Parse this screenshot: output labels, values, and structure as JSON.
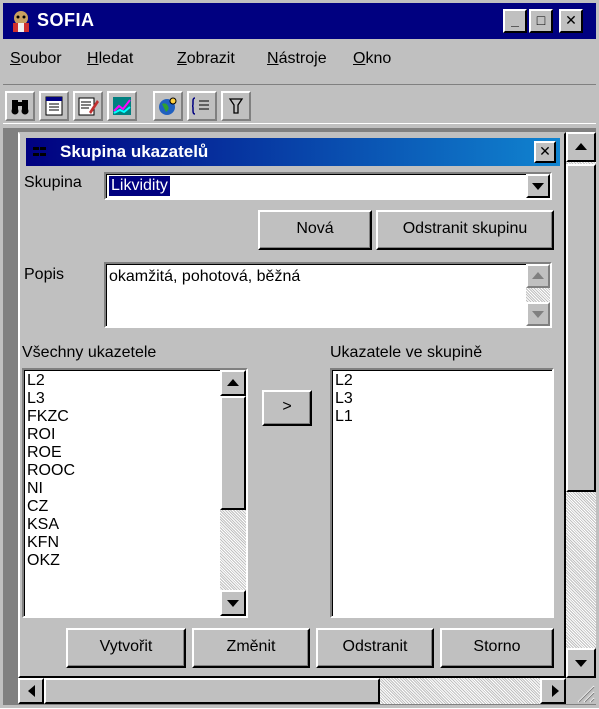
{
  "window": {
    "title": "SOFIA",
    "controls": {
      "minimize": "_",
      "maximize": "□",
      "close": "✕"
    }
  },
  "menu": [
    "Soubor",
    "Hledat",
    "Zobrazit",
    "Nástroje",
    "Okno"
  ],
  "toolbar": {
    "icons": [
      "binoculars-icon",
      "table-icon",
      "edit-icon",
      "chart-icon",
      "globe-icon",
      "list-icon",
      "help-icon"
    ]
  },
  "dialog": {
    "title": "Skupina ukazatelů",
    "close": "✕",
    "group": {
      "label": "Skupina",
      "value": "Likvidity"
    },
    "buttons": {
      "new": "Nová",
      "remove_group": "Odstranit skupinu"
    },
    "description": {
      "label": "Popis",
      "value": "okamžitá, pohotová, běžná"
    },
    "all_indicators": {
      "label": "Všechny ukazetele",
      "items": [
        "L2",
        "L3",
        "FKZC",
        "ROI",
        "ROE",
        "ROOC",
        "NI",
        "CZ",
        "KSA",
        "KFN",
        "OKZ"
      ]
    },
    "move_button": ">",
    "group_indicators": {
      "label": "Ukazatele ve skupině",
      "items": [
        "L2",
        "L3",
        "L1"
      ]
    },
    "footer": {
      "create": "Vytvořit",
      "change": "Změnit",
      "delete": "Odstranit",
      "cancel": "Storno"
    }
  },
  "colors": {
    "titlebar": "#000080",
    "face": "#c0c0c0",
    "selection": "#000080"
  }
}
